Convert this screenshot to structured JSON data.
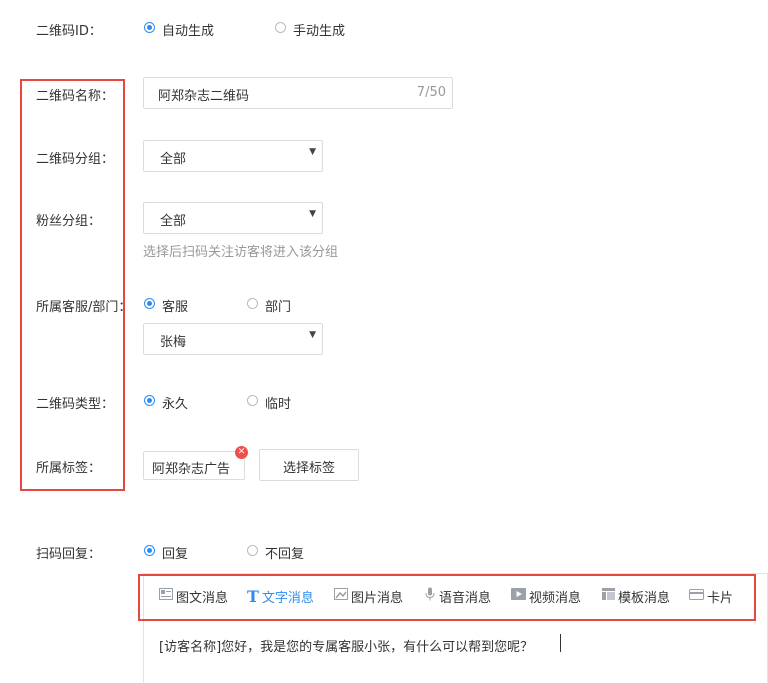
{
  "form": {
    "qr_id_label": "二维码ID：",
    "qr_id_options": [
      "自动生成",
      "手动生成"
    ],
    "qr_name_label": "二维码名称：",
    "qr_name_value": "阿郑杂志二维码",
    "qr_name_counter": "7/50",
    "qr_group_label": "二维码分组：",
    "qr_group_value": "全部",
    "fan_group_label": "粉丝分组：",
    "fan_group_value": "全部",
    "fan_group_hint": "选择后扫码关注访客将进入该分组",
    "service_label": "所属客服/部门：",
    "service_options": [
      "客服",
      "部门"
    ],
    "service_value": "张梅",
    "qr_type_label": "二维码类型：",
    "qr_type_options": [
      "永久",
      "临时"
    ],
    "tag_label": "所属标签：",
    "tag_value": "阿郑杂志广告",
    "tag_button": "选择标签",
    "reply_label": "扫码回复：",
    "reply_options": [
      "回复",
      "不回复"
    ]
  },
  "toolbar": {
    "items": [
      "图文消息",
      "文字消息",
      "图片消息",
      "语音消息",
      "视频消息",
      "模板消息",
      "卡片"
    ],
    "icons": [
      "news-icon",
      "text-icon",
      "image-icon",
      "microphone-icon",
      "video-icon",
      "template-icon",
      "card-icon"
    ],
    "active_index": 1
  },
  "message": {
    "text": "[访客名称]您好，我是您的专属客服小张，有什么可以帮到您呢？"
  },
  "colors": {
    "accent": "#2d8cf0",
    "highlight_box": "#e5483f",
    "tag_close": "#f0504d"
  }
}
